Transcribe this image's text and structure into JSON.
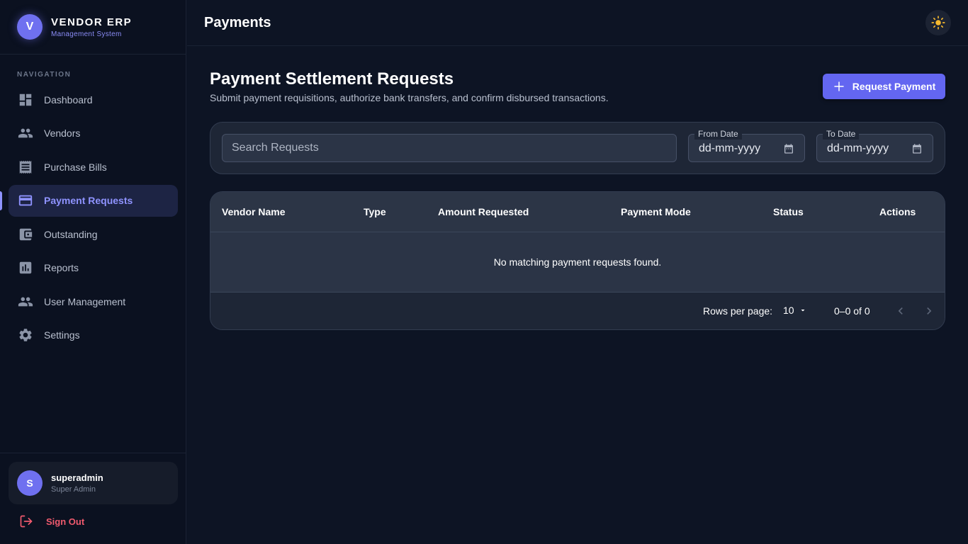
{
  "brand": {
    "initial": "V",
    "name": "VENDOR ERP",
    "subtitle": "Management System"
  },
  "nav": {
    "label": "NAVIGATION",
    "items": [
      {
        "label": "Dashboard",
        "icon": "dashboard-icon"
      },
      {
        "label": "Vendors",
        "icon": "people-icon"
      },
      {
        "label": "Purchase Bills",
        "icon": "receipt-icon"
      },
      {
        "label": "Payment Requests",
        "icon": "credit-card-icon",
        "active": true
      },
      {
        "label": "Outstanding",
        "icon": "wallet-icon"
      },
      {
        "label": "Reports",
        "icon": "bar-chart-icon"
      },
      {
        "label": "User Management",
        "icon": "people-icon"
      },
      {
        "label": "Settings",
        "icon": "gear-icon"
      }
    ]
  },
  "user": {
    "initial": "S",
    "name": "superadmin",
    "role": "Super Admin"
  },
  "signout": {
    "label": "Sign Out"
  },
  "topbar": {
    "title": "Payments",
    "theme_icon": "sun-icon"
  },
  "page": {
    "heading": "Payment Settlement Requests",
    "subheading": "Submit payment requisitions, authorize bank transfers, and confirm disbursed transactions.",
    "primary_button": "Request Payment"
  },
  "filters": {
    "search_placeholder": "Search Requests",
    "from_label": "From Date",
    "from_value": "dd-mm-yyyy",
    "to_label": "To Date",
    "to_value": "dd-mm-yyyy"
  },
  "table": {
    "columns": [
      "Vendor Name",
      "Type",
      "Amount Requested",
      "Payment Mode",
      "Status",
      "Actions"
    ],
    "empty_message": "No matching payment requests found.",
    "rows_per_page_label": "Rows per page:",
    "rows_per_page_value": "10",
    "range": "0–0 of 0"
  },
  "colors": {
    "accent": "#6366f1",
    "active_nav": "#8f93ff",
    "danger": "#f05a6e",
    "background": "#0d1424"
  }
}
